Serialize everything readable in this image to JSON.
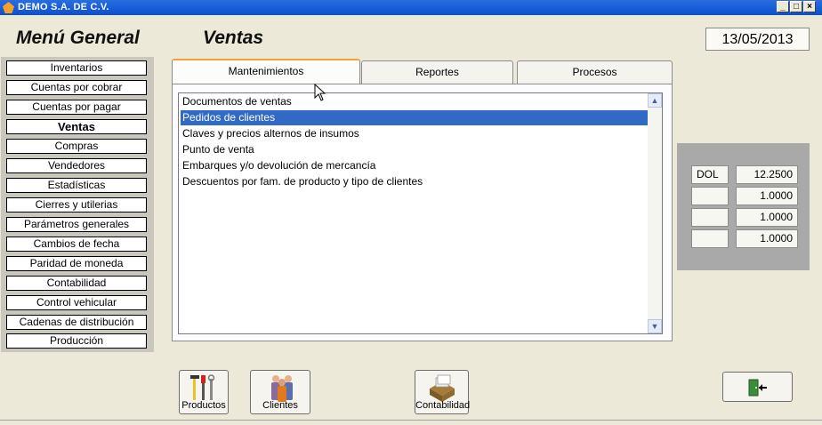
{
  "window": {
    "title": "DEMO  S.A. DE C.V.",
    "minimize": "_",
    "maximize": "□",
    "close": "×"
  },
  "header": {
    "menu_title": "Menú General",
    "section_title": "Ventas",
    "date": "13/05/2013"
  },
  "sidebar": {
    "items": [
      {
        "label": "Inventarios"
      },
      {
        "label": "Cuentas por cobrar"
      },
      {
        "label": "Cuentas por pagar"
      },
      {
        "label": "Ventas"
      },
      {
        "label": "Compras"
      },
      {
        "label": "Vendedores"
      },
      {
        "label": "Estadísticas"
      },
      {
        "label": "Cierres y utilerias"
      },
      {
        "label": "Parámetros generales"
      },
      {
        "label": "Cambios de fecha"
      },
      {
        "label": "Paridad de moneda"
      },
      {
        "label": "Contabilidad"
      },
      {
        "label": "Control vehicular"
      },
      {
        "label": "Cadenas de distribución"
      },
      {
        "label": "Producción"
      }
    ],
    "active_index": 3
  },
  "tabs": [
    {
      "label": "Mantenimientos"
    },
    {
      "label": "Reportes"
    },
    {
      "label": "Procesos"
    }
  ],
  "list": {
    "items": [
      "Documentos de ventas",
      "Pedidos de clientes",
      "Claves y precios alternos de insumos",
      "Punto de venta",
      "Embarques y/o devolución de mercancía",
      "Descuentos por fam. de producto y tipo de clientes"
    ],
    "selected_index": 1
  },
  "rates": [
    {
      "currency": "DOL",
      "value": "12.2500"
    },
    {
      "currency": "",
      "value": "1.0000"
    },
    {
      "currency": "",
      "value": "1.0000"
    },
    {
      "currency": "",
      "value": "1.0000"
    }
  ],
  "toolbar": {
    "productos": "Productos",
    "clientes": "Clientes",
    "contabilidad": "Contabilidad"
  },
  "colors": {
    "titlebar": "#0a4fd0",
    "selection": "#316ac5",
    "tab_accent": "#f2a23a"
  }
}
